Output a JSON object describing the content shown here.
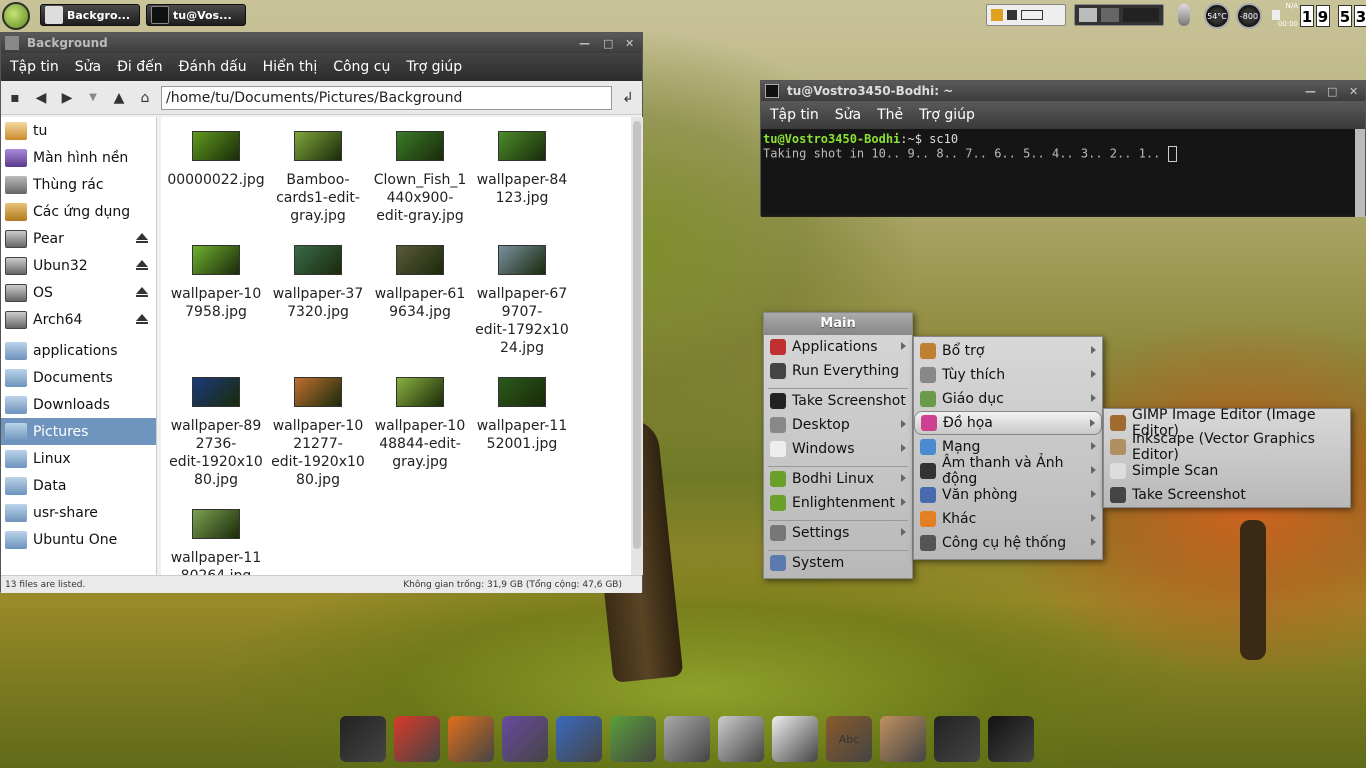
{
  "top_panel": {
    "tasks": [
      {
        "label": "Backgro..."
      },
      {
        "label": "tu@Vos..."
      }
    ],
    "temperature": "54°C",
    "fan": "-800",
    "battery_label": "N/A",
    "battery_time": "00:00",
    "clock": [
      "1",
      "9",
      "5",
      "3"
    ]
  },
  "file_manager": {
    "title": "Background",
    "menu": [
      "Tập tin",
      "Sửa",
      "Đi đến",
      "Đánh dấu",
      "Hiển thị",
      "Công cụ",
      "Trợ giúp"
    ],
    "path": "/home/tu/Documents/Pictures/Background",
    "sidebar": [
      {
        "label": "tu",
        "icon": "home-icon"
      },
      {
        "label": "Màn hình nền",
        "icon": "desktop-icon"
      },
      {
        "label": "Thùng rác",
        "icon": "trash-icon"
      },
      {
        "label": "Các ứng dụng",
        "icon": "applications-icon"
      },
      {
        "label": "Pear",
        "icon": "drive-icon",
        "eject": true
      },
      {
        "label": "Ubun32",
        "icon": "drive-icon",
        "eject": true
      },
      {
        "label": "OS",
        "icon": "drive-icon",
        "eject": true
      },
      {
        "label": "Arch64",
        "icon": "drive-icon",
        "eject": true
      },
      {
        "label": "applications",
        "icon": "folder-icon"
      },
      {
        "label": "Documents",
        "icon": "folder-icon"
      },
      {
        "label": "Downloads",
        "icon": "folder-icon"
      },
      {
        "label": "Pictures",
        "icon": "folder-icon",
        "selected": true
      },
      {
        "label": "Linux",
        "icon": "folder-icon"
      },
      {
        "label": "Data",
        "icon": "folder-icon"
      },
      {
        "label": "usr-share",
        "icon": "folder-icon"
      },
      {
        "label": "Ubuntu One",
        "icon": "folder-icon"
      }
    ],
    "files": [
      {
        "lines": [
          "00000022.jpg"
        ],
        "color": "#5f9a1e"
      },
      {
        "lines": [
          "Bamboo-",
          "cards1-edit-",
          "gray.jpg"
        ],
        "color": "#7fa63a"
      },
      {
        "lines": [
          "Clown_Fish_1",
          "440x900-",
          "edit-gray.jpg"
        ],
        "color": "#3a7a2a"
      },
      {
        "lines": [
          "wallpaper-84",
          "123.jpg"
        ],
        "color": "#4b8b2a"
      },
      {
        "lines": [
          "wallpaper-10",
          "7958.jpg"
        ],
        "color": "#6fb030"
      },
      {
        "lines": [
          "wallpaper-37",
          "7320.jpg"
        ],
        "color": "#3a6a4a"
      },
      {
        "lines": [
          "wallpaper-61",
          "9634.jpg"
        ],
        "color": "#5a5a3a"
      },
      {
        "lines": [
          "wallpaper-67",
          "9707-",
          "edit-1792x10",
          "24.jpg"
        ],
        "color": "#7890a0"
      },
      {
        "lines": [
          "wallpaper-89",
          "2736-",
          "edit-1920x10",
          "80.jpg"
        ],
        "color": "#1a3a7a"
      },
      {
        "lines": [
          "wallpaper-10",
          "21277-",
          "edit-1920x10",
          "80.jpg"
        ],
        "color": "#c07030"
      },
      {
        "lines": [
          "wallpaper-10",
          "48844-edit-",
          "gray.jpg"
        ],
        "color": "#8ab040"
      },
      {
        "lines": [
          "wallpaper-11",
          "52001.jpg"
        ],
        "color": "#2a5a1a"
      },
      {
        "lines": [
          "wallpaper-11",
          "80264.jpg"
        ],
        "color": "#7aa050"
      }
    ],
    "status_left": "13 files are listed.",
    "status_right": "Không gian trống: 31,9 GB (Tổng cộng: 47,6 GB)"
  },
  "terminal": {
    "title": "tu@Vostro3450-Bodhi: ~",
    "menu": [
      "Tập tin",
      "Sửa",
      "Thẻ",
      "Trợ giúp"
    ],
    "prompt": "tu@Vostro3450-Bodhi",
    "prompt_rest": ":~$ sc10",
    "output": "Taking shot in 10.. 9.. 8.. 7.. 6.. 5.. 4.. 3.. 2.. 1.."
  },
  "main_menu": {
    "title": "Main",
    "groups": [
      [
        {
          "label": "Applications",
          "sub": true,
          "color": "#c03030"
        },
        {
          "label": "Run Everything",
          "sub": false,
          "color": "#444"
        }
      ],
      [
        {
          "label": "Take Screenshot",
          "sub": false,
          "color": "#222"
        },
        {
          "label": "Desktop",
          "sub": true,
          "color": "#888"
        },
        {
          "label": "Windows",
          "sub": true,
          "color": "#eee"
        }
      ],
      [
        {
          "label": "Bodhi Linux",
          "sub": true,
          "color": "#6aa02a"
        },
        {
          "label": "Enlightenment",
          "sub": true,
          "color": "#6aa02a"
        }
      ],
      [
        {
          "label": "Settings",
          "sub": true,
          "color": "#777"
        }
      ],
      [
        {
          "label": "System",
          "sub": false,
          "color": "#5a7ab0"
        }
      ]
    ]
  },
  "apps_menu": [
    {
      "label": "Bổ trợ",
      "color": "#c08030"
    },
    {
      "label": "Tùy thích",
      "color": "#888"
    },
    {
      "label": "Giáo dục",
      "color": "#6a9a4a"
    },
    {
      "label": "Đồ họa",
      "color": "#d04090",
      "selected": true
    },
    {
      "label": "Mạng",
      "color": "#4a8ad0"
    },
    {
      "label": "Âm thanh và Ảnh động",
      "color": "#333"
    },
    {
      "label": "Văn phòng",
      "color": "#4a6ab0"
    },
    {
      "label": "Khác",
      "color": "#e08020"
    },
    {
      "label": "Công cụ hệ thống",
      "color": "#555"
    }
  ],
  "graphics_menu": [
    {
      "label": "GIMP Image Editor (Image Editor)",
      "color": "#a06a30"
    },
    {
      "label": "Inkscape (Vector Graphics Editor)",
      "color": "#b09060"
    },
    {
      "label": "Simple Scan",
      "color": "#ddd"
    },
    {
      "label": "Take Screenshot",
      "color": "#444"
    }
  ],
  "dock": [
    {
      "name": "monitor-icon",
      "color": "#222"
    },
    {
      "name": "chrome-icon",
      "color": "#d83a2a"
    },
    {
      "name": "firefox-icon",
      "color": "#e0701a"
    },
    {
      "name": "pidgin-icon",
      "color": "#6a4aa0"
    },
    {
      "name": "document-icon",
      "color": "#3a6ac0"
    },
    {
      "name": "spreadsheet-icon",
      "color": "#5aa03a"
    },
    {
      "name": "drive-icon",
      "color": "#aaa"
    },
    {
      "name": "calculator-icon",
      "color": "#ccc"
    },
    {
      "name": "text-editor-icon",
      "color": "#eee"
    },
    {
      "name": "dictionary-icon",
      "color": "#8a5a2a",
      "text": "Abc"
    },
    {
      "name": "package-installer-icon",
      "color": "#c09060"
    },
    {
      "name": "system-monitor-icon",
      "color": "#222"
    },
    {
      "name": "terminal-icon",
      "color": "#111"
    }
  ]
}
